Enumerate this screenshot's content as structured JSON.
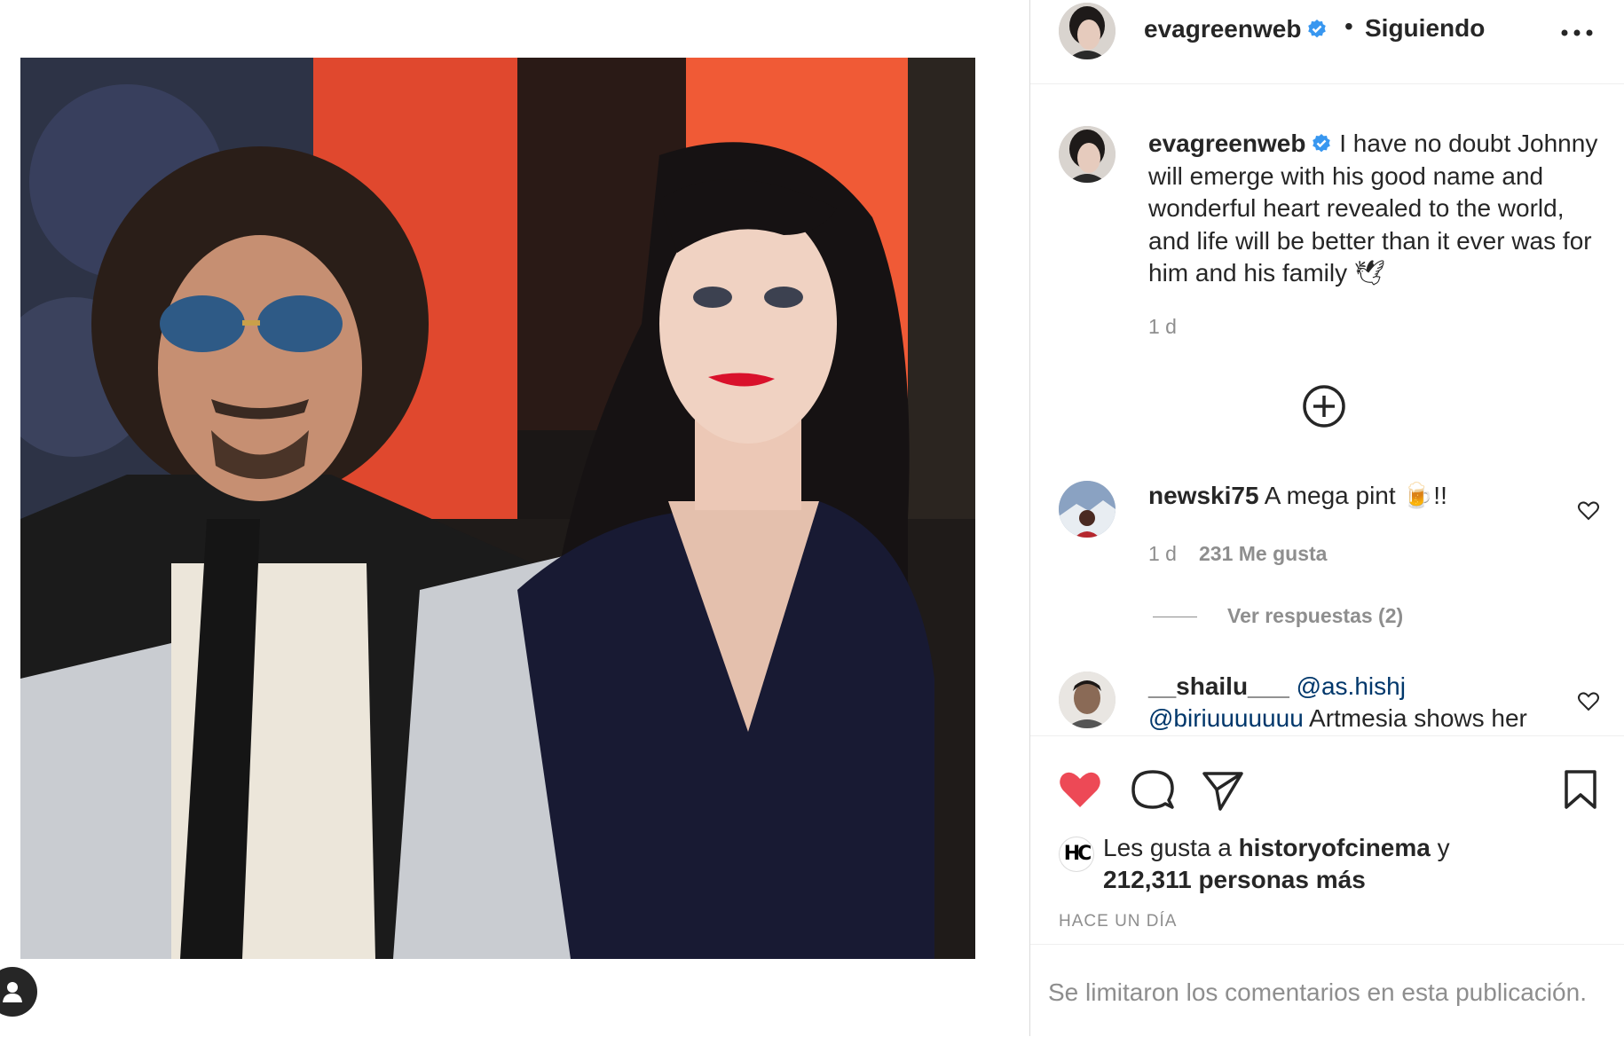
{
  "post": {
    "author": "evagreenweb",
    "follow_state": "Siguiendo",
    "dot": "•",
    "caption": "I have no doubt Johnny will emerge with his good name and wonderful heart revealed to the world, and life will be better than it ever was for him and his family 🕊",
    "caption_time": "1 d"
  },
  "comments": [
    {
      "user": "newski75",
      "text": "A mega pint 🍺!!",
      "time": "1 d",
      "likes": "231 Me gusta",
      "replies": "Ver respuestas (2)"
    },
    {
      "user": "__shailu___",
      "mention1": "@as.hishj",
      "mention2": "@biriuuuuuuu",
      "text": "Artmesia shows her"
    }
  ],
  "liked_by": {
    "logo": "HC",
    "prefix": "Les gusta a",
    "user": "historyofcinema",
    "conj": "y",
    "others": "212,311 personas más"
  },
  "post_date": "HACE UN DÍA",
  "comments_limited": "Se limitaron los comentarios en esta publicación.",
  "icons": {
    "like": "heart-filled-icon",
    "comment": "comment-icon",
    "share": "paper-plane-icon",
    "save": "bookmark-icon",
    "more": "more-options-icon",
    "add": "plus-circle-icon",
    "tag": "user-tag-icon"
  },
  "colors": {
    "like_red": "#ed4956",
    "verified_blue": "#3897f0",
    "secondary_text": "#8e8e8e",
    "mention": "#00376b"
  }
}
